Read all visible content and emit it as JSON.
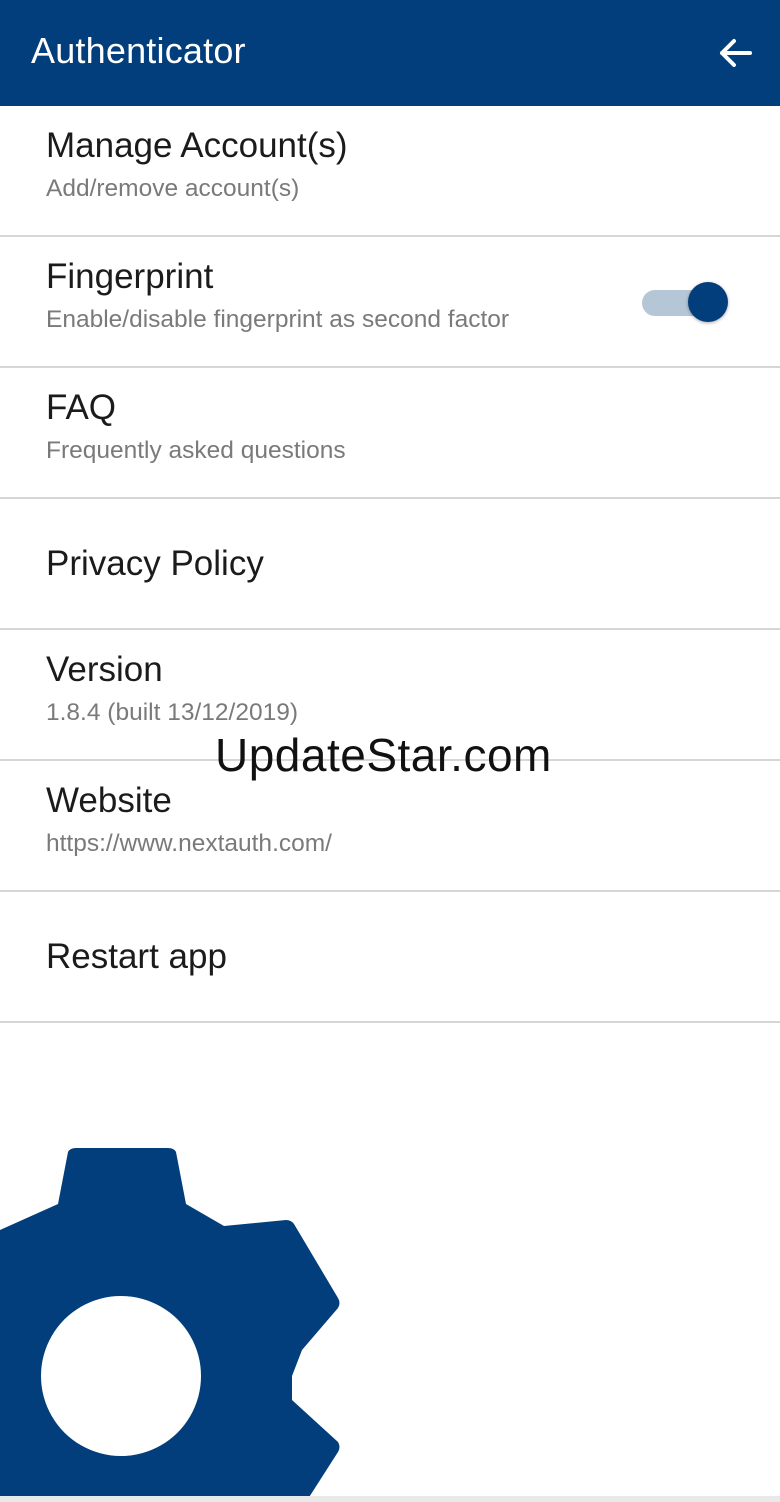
{
  "app_bar": {
    "title": "Authenticator",
    "back_icon": "arrow-left-icon",
    "background_color": "#033e7c"
  },
  "settings": [
    {
      "id": "manage-accounts",
      "title": "Manage Account(s)",
      "subtitle": "Add/remove account(s)"
    },
    {
      "id": "fingerprint",
      "title": "Fingerprint",
      "subtitle": "Enable/disable fingerprint as second factor",
      "toggle_on": true
    },
    {
      "id": "faq",
      "title": "FAQ",
      "subtitle": "Frequently asked questions"
    },
    {
      "id": "privacy-policy",
      "title": "Privacy Policy"
    },
    {
      "id": "version",
      "title": "Version",
      "subtitle": "1.8.4 (built 13/12/2019)"
    },
    {
      "id": "website",
      "title": "Website",
      "subtitle": "https://www.nextauth.com/"
    },
    {
      "id": "restart-app",
      "title": "Restart app"
    }
  ],
  "watermark": "UpdateStar.com",
  "decoration": {
    "icon": "gear-icon",
    "color": "#033e7c"
  }
}
